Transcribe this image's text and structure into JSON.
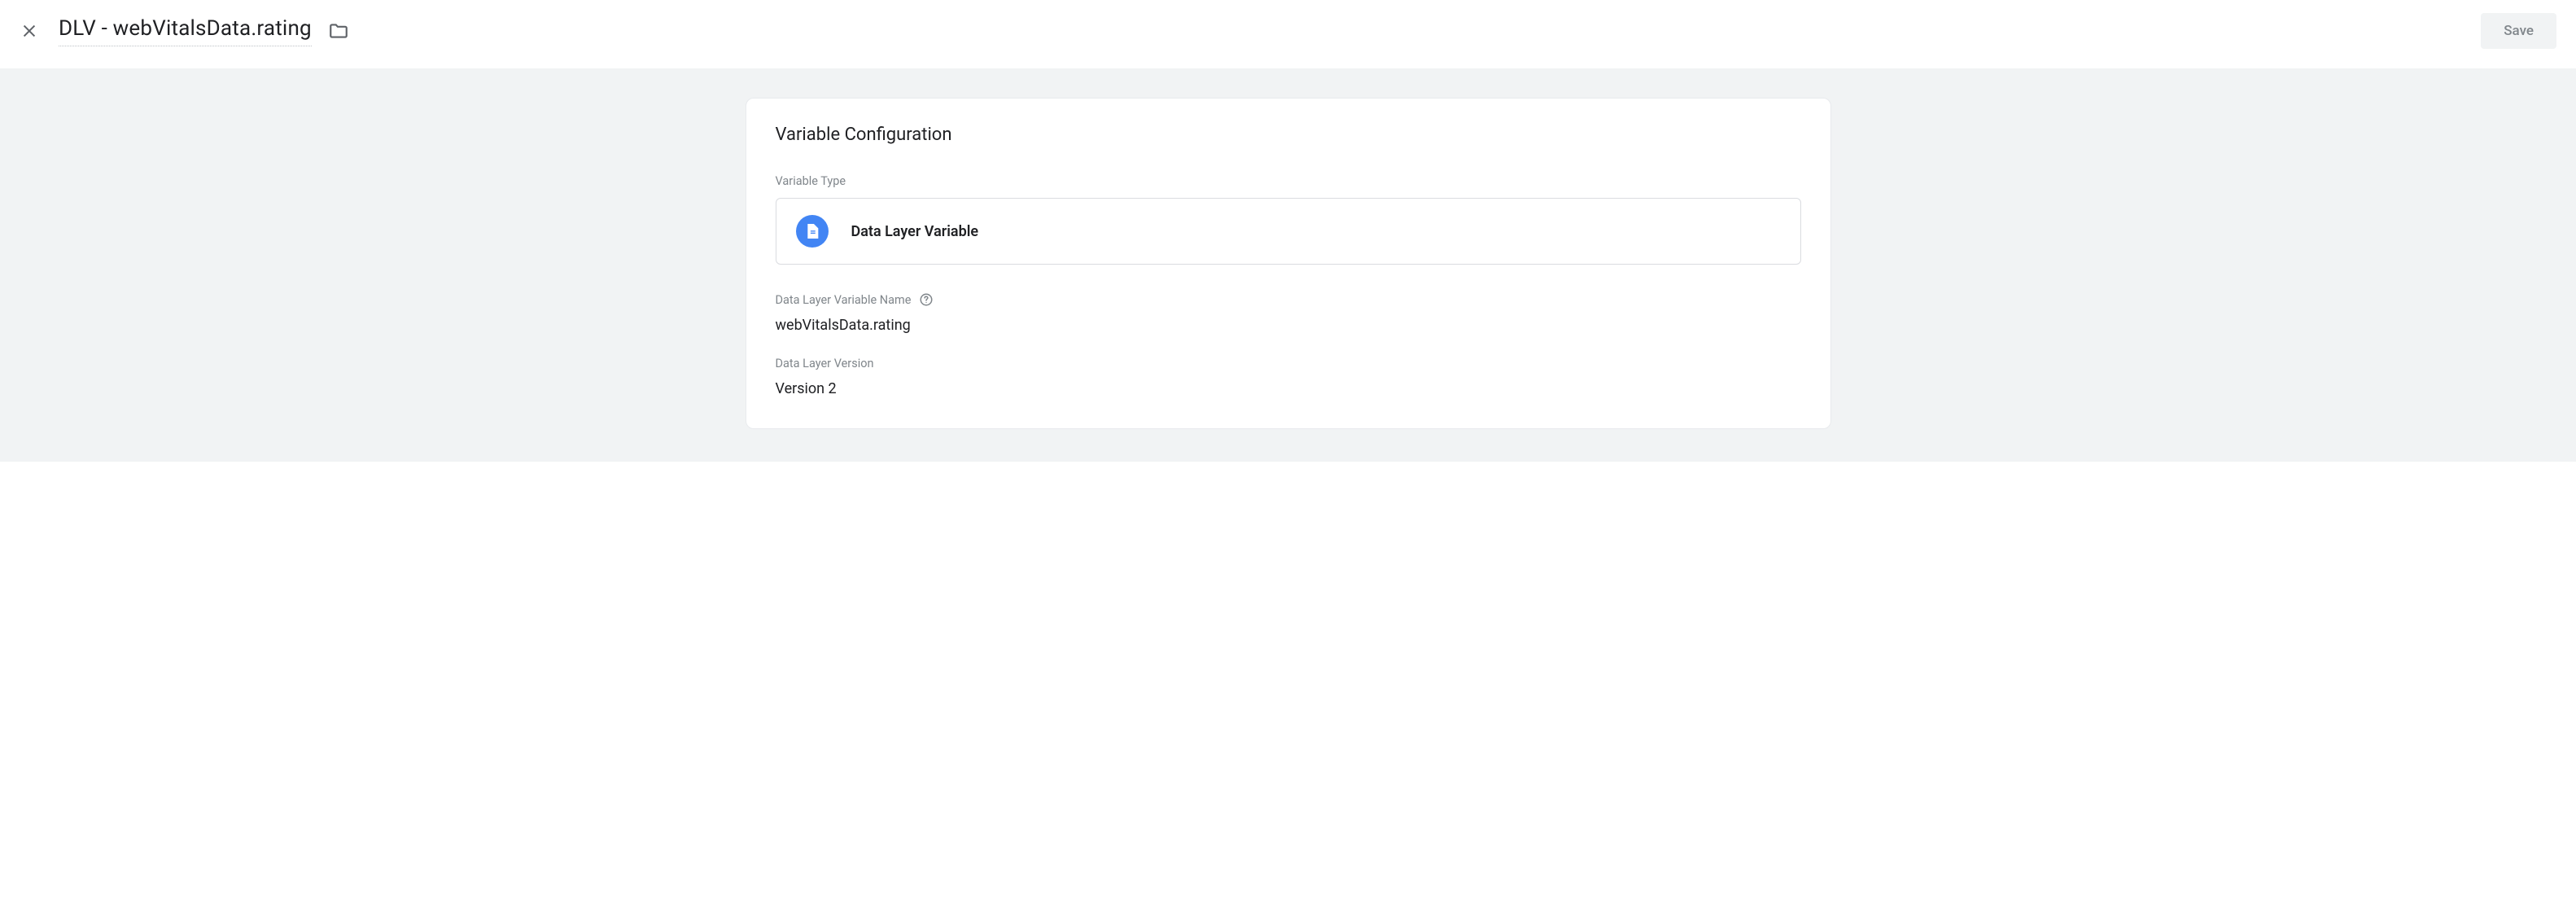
{
  "header": {
    "title": "DLV - webVitalsData.rating",
    "save_label": "Save"
  },
  "card": {
    "title": "Variable Configuration",
    "variable_type_label": "Variable Type",
    "variable_type_value": "Data Layer Variable",
    "variable_name_label": "Data Layer Variable Name",
    "variable_name_value": "webVitalsData.rating",
    "version_label": "Data Layer Version",
    "version_value": "Version 2"
  }
}
